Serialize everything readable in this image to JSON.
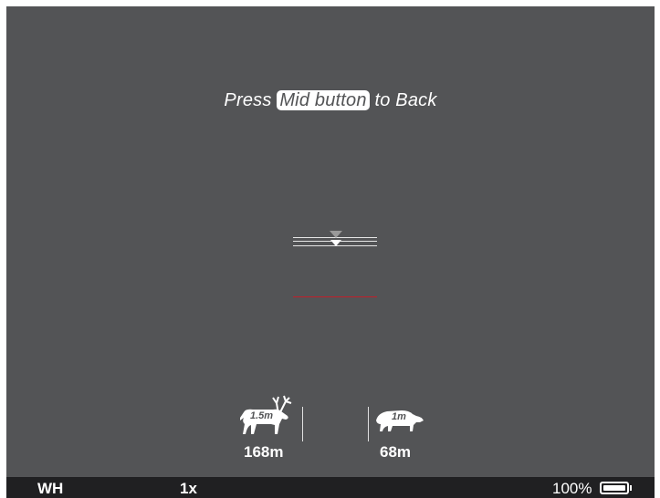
{
  "message": {
    "prefix": "Press",
    "highlight": "Mid button",
    "suffix": "to Back"
  },
  "rangefinder": {
    "animals": [
      {
        "name": "deer",
        "size_label": "1.5m",
        "distance": "168m"
      },
      {
        "name": "boar",
        "size_label": "1m",
        "distance": "68m"
      }
    ],
    "marker_color": "#c0202a"
  },
  "status": {
    "mode": "WH",
    "zoom": "1x",
    "battery": "100%"
  }
}
